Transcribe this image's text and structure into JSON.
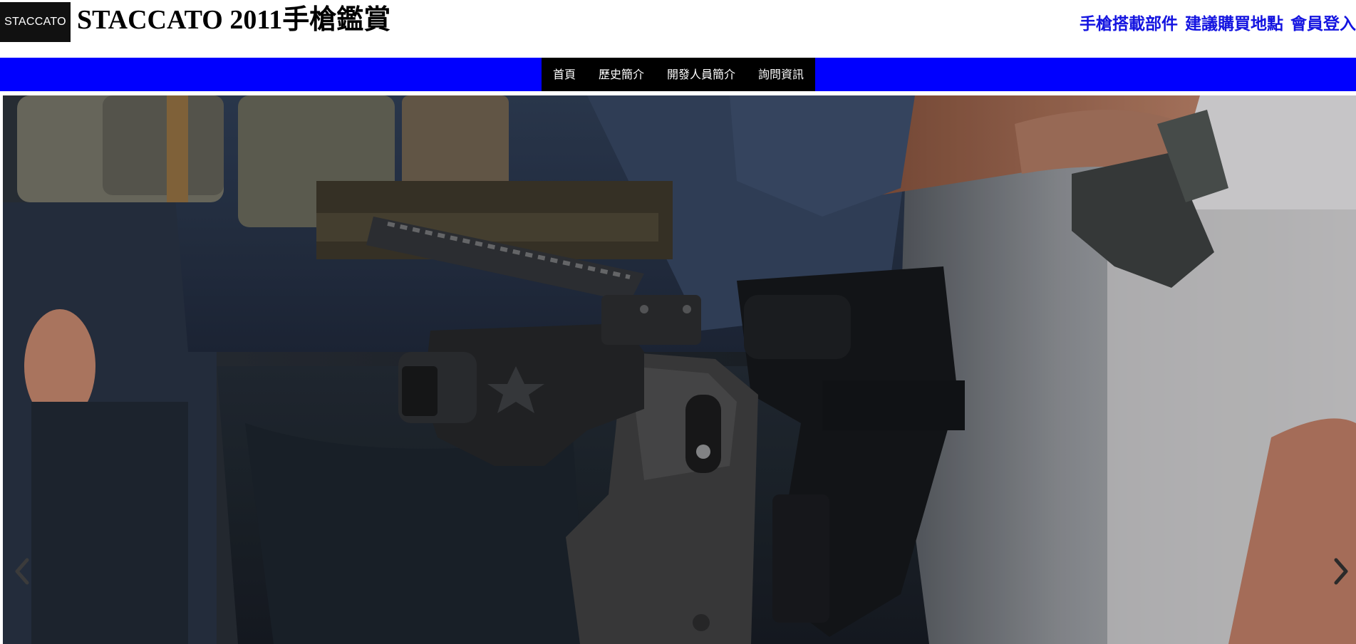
{
  "header": {
    "logo_text": "STACCATO",
    "site_title": "STACCATO 2011手槍鑑賞",
    "links": [
      "手槍搭載部件",
      "建議購買地點",
      "會員登入"
    ]
  },
  "nav": {
    "items": [
      "首頁",
      "歷史簡介",
      "開發人員簡介",
      "詢問資訊"
    ]
  },
  "carousel": {
    "prev_icon": "chevron-left-icon",
    "next_icon": "chevron-right-icon",
    "slide_description_icon": "holstered-pistol-photo"
  },
  "colors": {
    "nav_bar": "#0000ff",
    "nav_menu": "#000000",
    "top_links": "#1414e0",
    "logo_bg": "#111111"
  }
}
